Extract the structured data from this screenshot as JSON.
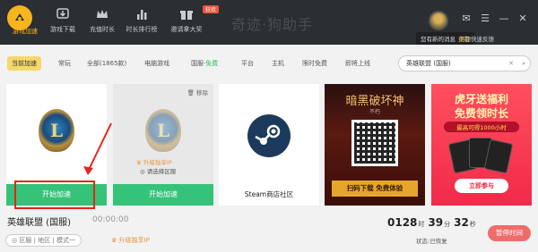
{
  "nav": {
    "items": [
      {
        "label": "游戏加速",
        "icon": "rocket-icon",
        "active": true
      },
      {
        "label": "游戏下载",
        "icon": "download-icon"
      },
      {
        "label": "充值时长",
        "icon": "crown-icon"
      },
      {
        "label": "时长排行榜",
        "icon": "bar-chart-icon"
      },
      {
        "label": "邀请拿大奖",
        "icon": "gift-icon"
      }
    ],
    "badge": "狂欢",
    "watermark": "奇迹·狗助手"
  },
  "tooltip": {
    "text": "您有新的消息",
    "link": "查看"
  },
  "feedback": "问题快速反馈",
  "filters": [
    {
      "label": "当前加速",
      "active": true
    },
    {
      "label": "常玩"
    },
    {
      "label": "全部(1865款)"
    },
    {
      "label": "电脑游戏"
    },
    {
      "label": "国服·",
      "free": "免费"
    },
    {
      "label": "平台"
    },
    {
      "label": "主机"
    },
    {
      "label": "限时免费"
    },
    {
      "label": "即将上线"
    }
  ],
  "search": {
    "value": "英雄联盟 (国服)"
  },
  "cards": {
    "card1": {
      "emblem": "L",
      "button": "开始加速"
    },
    "card2": {
      "remove": "移除",
      "vip": "升级独享IP",
      "region": "请选择区服",
      "button": "开始加速"
    },
    "card3": {
      "label": "Steam商店社区"
    }
  },
  "ad1": {
    "title": "暗黑破坏神",
    "subtitle": "不朽",
    "button": "扫码下载 免费体验"
  },
  "ad2": {
    "line1": "虎牙送福利",
    "line2": "免费领时长",
    "line3": "最高可得1000小时",
    "button": "立即参与"
  },
  "status": {
    "game": "英雄联盟 (国服)",
    "elapsed": "00:00:00",
    "region_pill": "区服 | 地区 | 模式一",
    "vip": "升级独享IP",
    "timer": {
      "days": "0128",
      "days_unit": "时",
      "minutes": "39",
      "minutes_unit": "分",
      "seconds": "32",
      "seconds_unit": "秒"
    },
    "state": "状态:已恢复",
    "pause": "暂停时间"
  },
  "colors": {
    "accent": "#f6b51c",
    "green": "#35c279",
    "topbar": "#2b2e33",
    "annotation": "#e8231c"
  }
}
